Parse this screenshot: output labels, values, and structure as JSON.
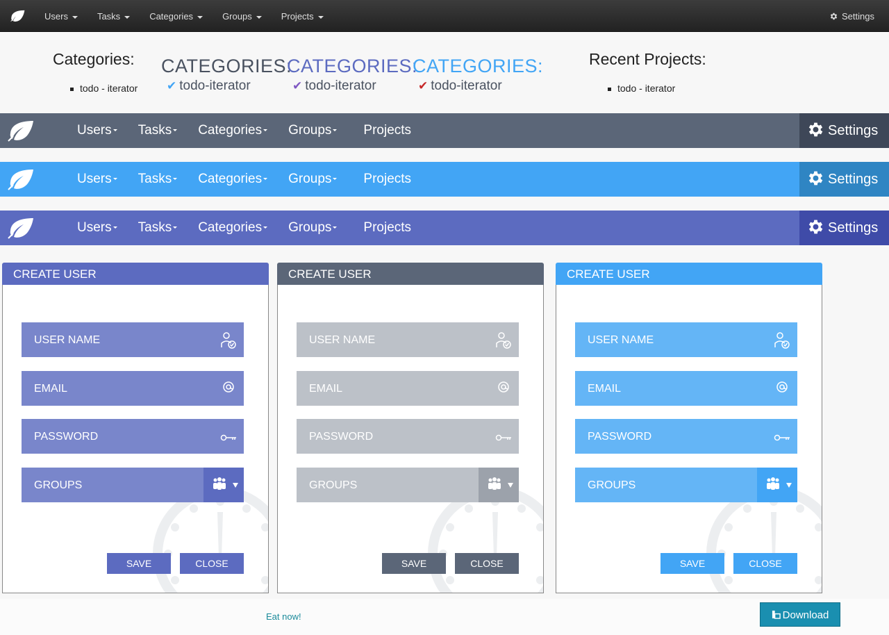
{
  "topbar": {
    "menu": [
      "Users",
      "Tasks",
      "Categories",
      "Groups",
      "Projects"
    ],
    "settings": "Settings"
  },
  "categories_section": {
    "heading": "Categories:",
    "item": "todo - iterator",
    "variants": [
      {
        "title": "CATEGORIES:",
        "item": "todo-iterator",
        "color": "#4a5260",
        "check_color": "#42a5f5"
      },
      {
        "title": "CATEGORIES:",
        "item": "todo-iterator",
        "color": "#5c6bc0",
        "check_color": "#7e57c2"
      },
      {
        "title": "CATEGORIES:",
        "item": "todo-iterator",
        "color": "#42a5f5",
        "check_color": "#c62828"
      }
    ]
  },
  "recent_projects": {
    "heading": "Recent Projects:",
    "item": "todo - iterator"
  },
  "navbars": [
    {
      "bg": "#5b6678",
      "settings_bg": "#3e4758",
      "items": [
        "Users",
        "Tasks",
        "Categories",
        "Groups",
        "Projects"
      ],
      "settings": "Settings"
    },
    {
      "bg": "#42a5f5",
      "settings_bg": "#2f85c3",
      "items": [
        "Users",
        "Tasks",
        "Categories",
        "Groups",
        "Projects"
      ],
      "settings": "Settings"
    },
    {
      "bg": "#5c6bc0",
      "settings_bg": "#3f4ba8",
      "items": [
        "Users",
        "Tasks",
        "Categories",
        "Groups",
        "Projects"
      ],
      "settings": "Settings"
    }
  ],
  "panels": [
    {
      "title": "CREATE USER",
      "header_bg": "#5c6bc0",
      "field_bg": "#7986cb",
      "group_btn_bg": "#5c6bc0",
      "button_bg": "#5c6bc0",
      "fields": [
        "USER NAME",
        "EMAIL",
        "PASSWORD",
        "GROUPS"
      ],
      "save": "SAVE",
      "close": "CLOSE"
    },
    {
      "title": "CREATE USER",
      "header_bg": "#5b6678",
      "field_bg": "#bcc1c8",
      "group_btn_bg": "#9ca2ab",
      "button_bg": "#5b6678",
      "fields": [
        "USER NAME",
        "EMAIL",
        "PASSWORD",
        "GROUPS"
      ],
      "save": "SAVE",
      "close": "CLOSE"
    },
    {
      "title": "CREATE USER",
      "header_bg": "#42a5f5",
      "field_bg": "#64b5f6",
      "group_btn_bg": "#42a5f5",
      "button_bg": "#42a5f5",
      "fields": [
        "USER NAME",
        "EMAIL",
        "PASSWORD",
        "GROUPS"
      ],
      "save": "SAVE",
      "close": "CLOSE"
    }
  ],
  "footer": {
    "link": "Eat now!",
    "download": "Download"
  }
}
